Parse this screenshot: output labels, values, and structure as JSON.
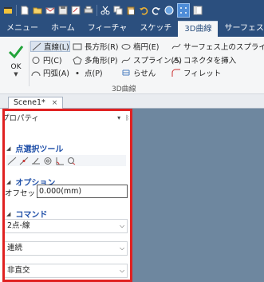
{
  "quick_access": {
    "icons": [
      "app-menu-icon",
      "new-file-icon",
      "open-folder-icon",
      "mail-icon",
      "save-icon",
      "save-as-icon",
      "print-icon",
      "cut-icon",
      "copy-icon",
      "paste-icon",
      "undo-icon",
      "redo-icon",
      "help-icon",
      "grid-snap-icon",
      "panel-toggle-icon"
    ]
  },
  "ribbon_tabs": [
    {
      "label": "メニュー"
    },
    {
      "label": "ホーム"
    },
    {
      "label": "フィーチャ"
    },
    {
      "label": "スケッチ"
    },
    {
      "label": "3D曲線",
      "active": true
    },
    {
      "label": "サーフェス"
    }
  ],
  "ribbon": {
    "ok_label": "OK",
    "buttons": {
      "line": "直線(L)",
      "rectangle": "長方形(R)",
      "ellipse": "楕円(E)",
      "surface_spline": "サーフェス上のスプライン",
      "circle": "円(C)",
      "polygon": "多角形(P)",
      "spline": "スプライン(S)",
      "insert_connector": "コネクタを挿入",
      "arc": "円弧(A)",
      "point": "点(P)",
      "helix": "らせん",
      "fillet": "フィレット"
    },
    "group_label": "3D曲線"
  },
  "document": {
    "tab_label": "Scene1*",
    "close_glyph": "×"
  },
  "panel": {
    "title": "プロパティ",
    "menu_glyph": "▾",
    "pin_glyph": "ᛒ",
    "point_tools_header": "点選択ツール",
    "point_tools": [
      "line-tool-icon",
      "snap-line-icon",
      "tangent-tool-icon",
      "target-circle-icon",
      "angle-tool-icon",
      "circle-pick-icon"
    ],
    "options_header": "オプション",
    "offset_label": "オフセット:",
    "offset_value": "0.000(mm)",
    "command_header": "コマンド",
    "command_mode": "2点-線",
    "continuity": "連続",
    "orthogonal": "非直交"
  },
  "colors": {
    "ribbon_bar": "#2b4f7e",
    "section_header": "#1f4fa8",
    "highlight_border": "#e02121",
    "viewport": "#6e879f"
  }
}
